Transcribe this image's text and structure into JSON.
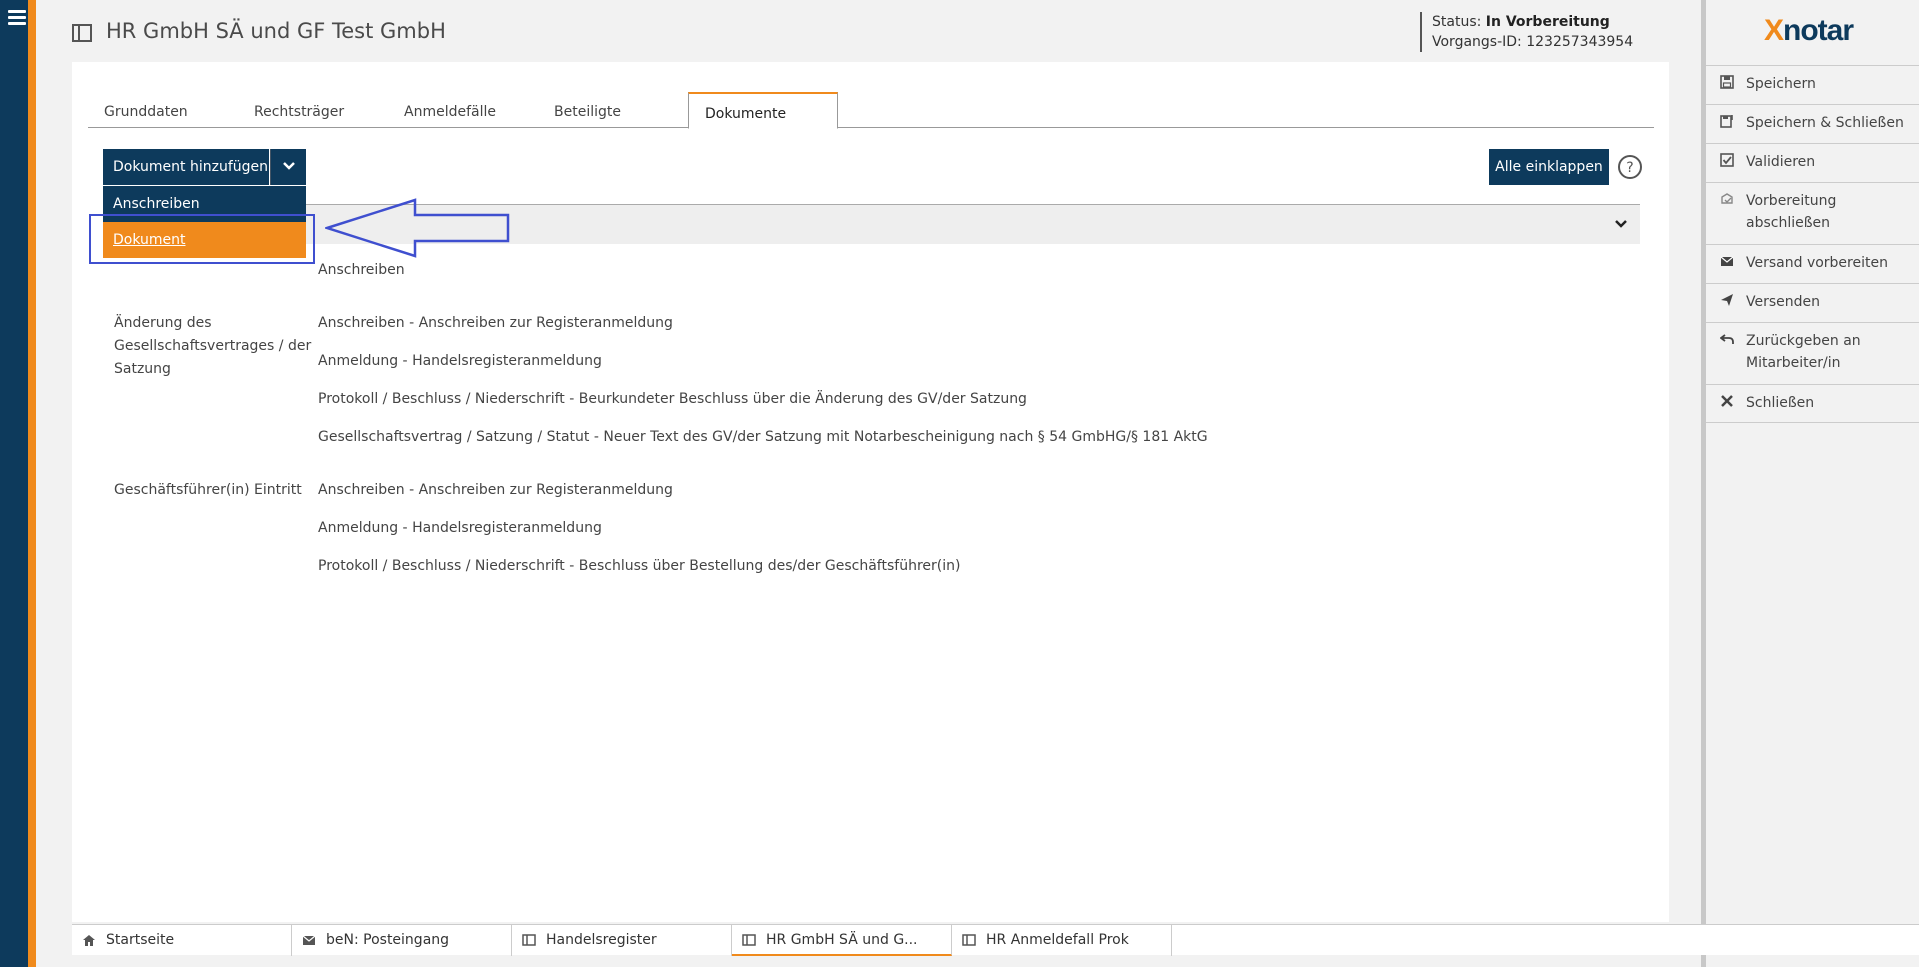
{
  "header": {
    "title": "HR GmbH SÄ und GF Test GmbH",
    "status_label": "Status:",
    "status_value": "In Vorbereitung",
    "vorgang_label": "Vorgangs-ID:",
    "vorgang_value": "123257343954"
  },
  "tabs": [
    {
      "label": "Grunddaten"
    },
    {
      "label": "Rechtsträger"
    },
    {
      "label": "Anmeldefälle"
    },
    {
      "label": "Beteiligte"
    },
    {
      "label": "Dokumente",
      "active": true
    }
  ],
  "toolbar": {
    "add_document": "Dokument hinzufügen",
    "collapse_all": "Alle einklappen"
  },
  "dropdown": [
    {
      "label": "Anschreiben"
    },
    {
      "label": "Dokument",
      "highlighted": true
    }
  ],
  "documents": {
    "general": "Anschreiben",
    "groups": [
      {
        "label": "Änderung des Gesellschaftsvertrages / der Satzung",
        "items": [
          "Anschreiben - Anschreiben zur Registeranmeldung",
          "Anmeldung - Handelsregisteranmeldung",
          "Protokoll / Beschluss / Niederschrift - Beurkundeter Beschluss über die Änderung des GV/der Satzung",
          "Gesellschaftsvertrag / Satzung / Statut - Neuer Text des GV/der Satzung mit Notarbescheinigung nach § 54 GmbHG/§ 181 AktG"
        ]
      },
      {
        "label": "Geschäftsführer(in) Eintritt",
        "items": [
          "Anschreiben - Anschreiben zur Registeranmeldung",
          "Anmeldung - Handelsregisteranmeldung",
          "Protokoll / Beschluss / Niederschrift - Beschluss über Bestellung des/der Geschäftsführer(in)"
        ]
      }
    ]
  },
  "sidebar": {
    "logo_x": "X",
    "logo_rest": "notar",
    "actions": [
      {
        "label": "Speichern",
        "icon": "save-icon"
      },
      {
        "label": "Speichern & Schließen",
        "icon": "save-close-icon"
      },
      {
        "label": "Validieren",
        "icon": "checkbox-icon"
      },
      {
        "label": "Vorbereitung abschließen",
        "icon": "finish-prep-icon"
      },
      {
        "label": "Versand vorbereiten",
        "icon": "envelope-icon"
      },
      {
        "label": "Versenden",
        "icon": "send-icon"
      },
      {
        "label": "Zurückgeben an Mitarbeiter/in",
        "icon": "return-icon"
      },
      {
        "label": "Schließen",
        "icon": "close-icon"
      }
    ]
  },
  "bottom_tabs": [
    {
      "label": "Startseite",
      "icon": "home-icon"
    },
    {
      "label": "beN: Posteingang",
      "icon": "envelope-icon"
    },
    {
      "label": "Handelsregister",
      "icon": "book-icon"
    },
    {
      "label": "HR GmbH SÄ und G...",
      "icon": "book-icon",
      "active": true
    },
    {
      "label": "HR Anmeldefall Prok",
      "icon": "book-icon"
    }
  ],
  "colors": {
    "navy": "#0d3a5c",
    "orange": "#f08a1c",
    "annotation": "#3f4fcf"
  }
}
